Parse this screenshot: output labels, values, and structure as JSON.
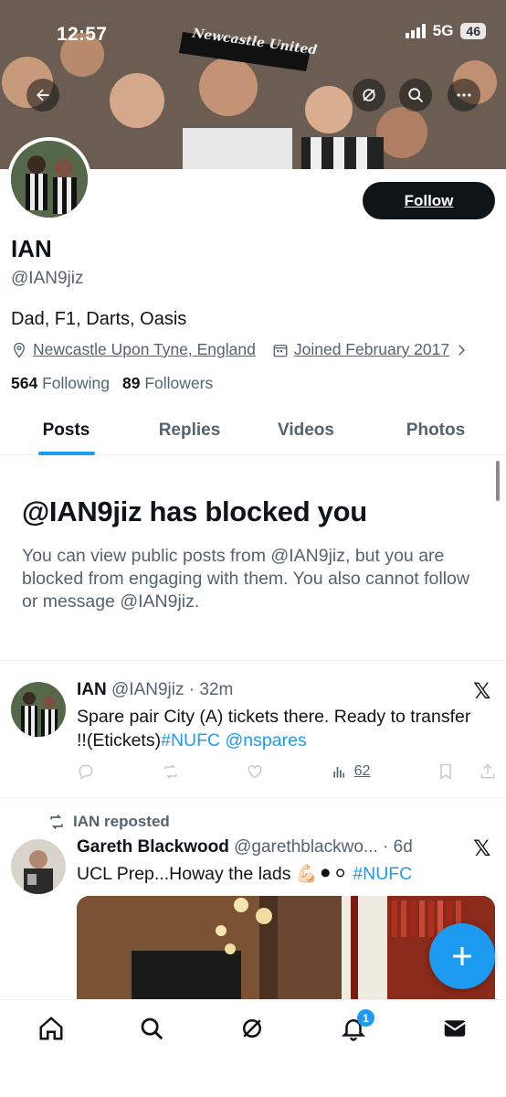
{
  "status_bar": {
    "time": "12:57",
    "network": "5G",
    "battery": "46"
  },
  "banner": {
    "scarf_text": "Newcastle United"
  },
  "profile": {
    "name": "IAN",
    "handle": "@IAN9jiz",
    "bio": "Dad, F1, Darts, Oasis",
    "location": "Newcastle Upon Tyne, England",
    "joined": "Joined February 2017",
    "following_count": "564",
    "following_label": "Following",
    "followers_count": "89",
    "followers_label": "Followers",
    "follow_label": "Follow"
  },
  "tabs": [
    {
      "label": "Posts",
      "active": true
    },
    {
      "label": "Replies",
      "active": false
    },
    {
      "label": "Videos",
      "active": false
    },
    {
      "label": "Photos",
      "active": false
    }
  ],
  "blocked": {
    "title": "@IAN9jiz has blocked you",
    "text": "You can view public posts from @IAN9jiz, but you are blocked from engaging with them. You also cannot follow or message @IAN9jiz."
  },
  "tweets": [
    {
      "author": "IAN",
      "handle": "@IAN9jiz",
      "time": "32m",
      "text_line1": "Spare pair City (A) tickets there. Ready to transfer",
      "text_line2_plain": "!!(Etickets)",
      "text_line2_links": "#NUFC @nspares",
      "views": "62"
    },
    {
      "reposted_by": "IAN reposted",
      "author": "Gareth Blackwood",
      "handle": "@garethblackwo...",
      "time": "6d",
      "text_plain": "UCL Prep...Howay the lads 💪🏻⚫⚪",
      "text_link": "#NUFC"
    }
  ],
  "notifications_badge": "1",
  "colors": {
    "accent": "#1d9bf0",
    "text": "#0f1419",
    "secondary": "#536471"
  },
  "icons": [
    "back-arrow-icon",
    "grok-icon",
    "search-icon",
    "more-icon",
    "location-pin-icon",
    "calendar-icon",
    "chevron-right-icon",
    "x-logo-icon",
    "reply-icon",
    "repost-icon",
    "like-icon",
    "views-icon",
    "bookmark-icon",
    "share-icon",
    "compose-plus-icon",
    "home-icon",
    "notifications-icon",
    "messages-icon"
  ]
}
